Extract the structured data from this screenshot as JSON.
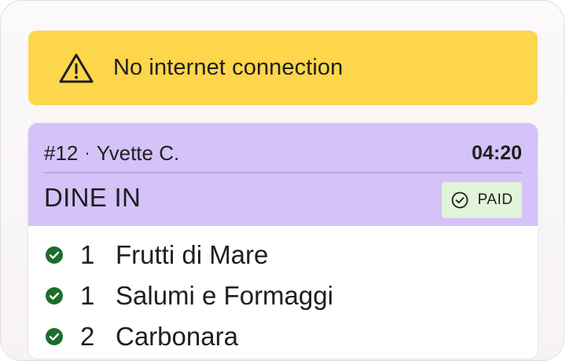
{
  "banner": {
    "icon": "warning-triangle-icon",
    "message": "No internet connection",
    "color": "#fdd64c"
  },
  "order": {
    "number": "#12",
    "separator": "·",
    "customer": "Yvette C.",
    "elapsed": "04:20",
    "type": "DINE IN",
    "payment_status": "PAID",
    "header_color": "#d4c2f9",
    "badge_color": "#e2f3dc",
    "items": [
      {
        "qty": "1",
        "name": "Frutti di Mare",
        "status_icon": "check-circle-icon"
      },
      {
        "qty": "1",
        "name": "Salumi e Formaggi",
        "status_icon": "check-circle-icon"
      },
      {
        "qty": "2",
        "name": "Carbonara",
        "status_icon": "check-circle-icon"
      }
    ]
  }
}
